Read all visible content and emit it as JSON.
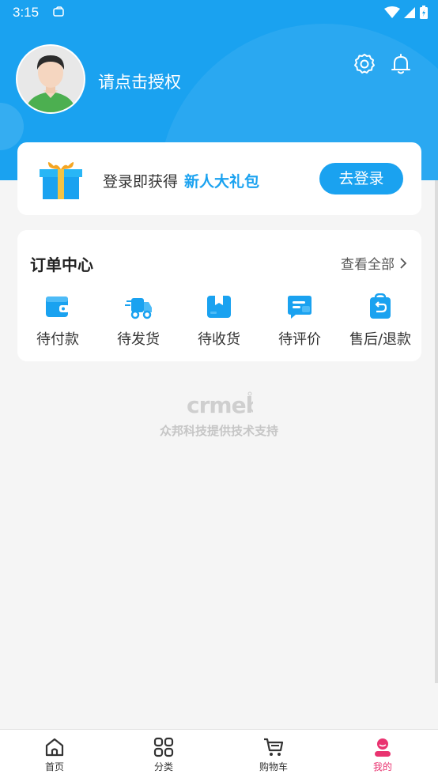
{
  "status_bar": {
    "time": "3:15"
  },
  "profile": {
    "username": "请点击授权"
  },
  "login_card": {
    "prompt": "登录即获得",
    "highlight": "新人大礼包",
    "button": "去登录"
  },
  "order_center": {
    "title": "订单中心",
    "view_all": "查看全部",
    "items": [
      {
        "label": "待付款",
        "icon": "wallet-icon"
      },
      {
        "label": "待发货",
        "icon": "truck-icon"
      },
      {
        "label": "待收货",
        "icon": "box-icon"
      },
      {
        "label": "待评价",
        "icon": "comment-icon"
      },
      {
        "label": "售后/退款",
        "icon": "refund-icon"
      }
    ]
  },
  "brand": {
    "logo_text": "crmeb",
    "support_text": "众邦科技提供技术支持"
  },
  "tabbar": {
    "tabs": [
      {
        "label": "首页",
        "icon": "home-icon"
      },
      {
        "label": "分类",
        "icon": "category-icon"
      },
      {
        "label": "购物车",
        "icon": "cart-icon"
      },
      {
        "label": "我的",
        "icon": "profile-icon"
      }
    ],
    "active": "我的"
  },
  "colors": {
    "primary": "#1aa2f0",
    "active_tab": "#e93370",
    "background": "#f5f5f5"
  }
}
